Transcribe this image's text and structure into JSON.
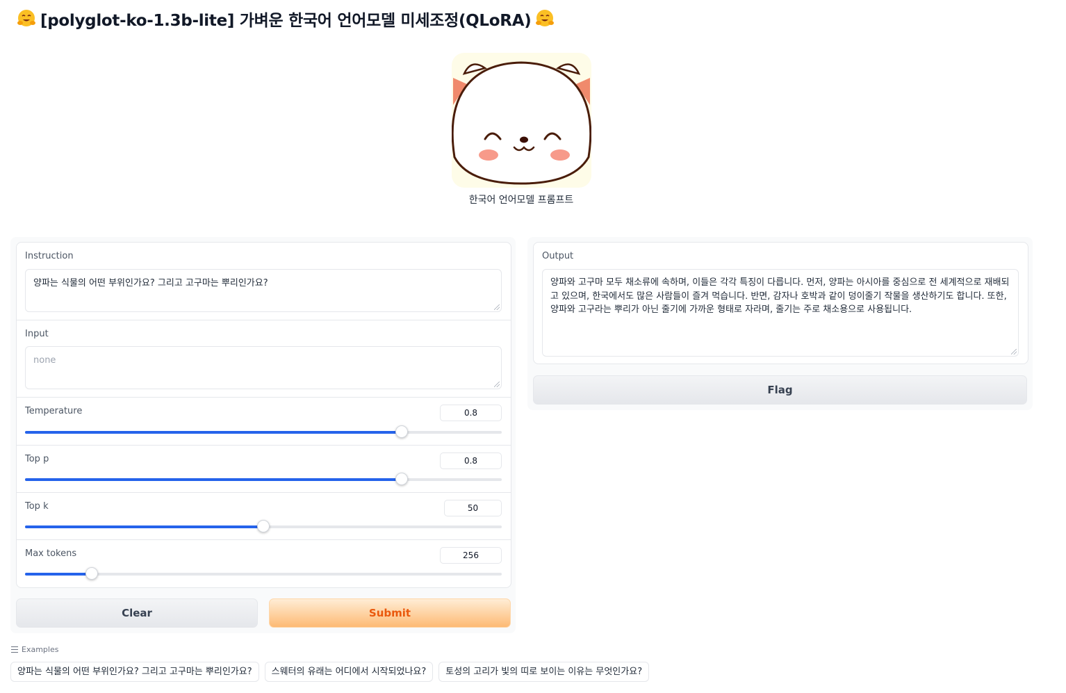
{
  "header": {
    "title": "[polyglot-ko-1.3b-lite] 가벼운 한국어 언어모델 미세조정(QLoRA)",
    "emoji_icon": "hugging-face-icon"
  },
  "mascot": {
    "icon": "cat-face-mascot",
    "caption": "한국어 언어모델 프롬프트"
  },
  "inputs": {
    "instruction": {
      "label": "Instruction",
      "value": "양파는 식물의 어떤 부위인가요? 그리고 고구마는 뿌리인가요?"
    },
    "input": {
      "label": "Input",
      "placeholder": "none"
    },
    "sliders": [
      {
        "label": "Temperature",
        "value": "0.8",
        "level": 0.79
      },
      {
        "label": "Top p",
        "value": "0.8",
        "level": 0.79
      },
      {
        "label": "Top k",
        "value": "50",
        "level": 0.5
      },
      {
        "label": "Max tokens",
        "value": "256",
        "level": 0.14
      }
    ]
  },
  "buttons": {
    "clear": "Clear",
    "submit": "Submit",
    "flag": "Flag"
  },
  "output": {
    "label": "Output",
    "value": "양파와 고구마 모두 채소류에 속하며, 이들은 각각 특징이 다릅니다. 먼저, 양파는 아시아를 중심으로 전 세계적으로 재배되고 있으며, 한국에서도 많은 사람들이 즐겨 먹습니다. 반면, 감자나 호박과 같이 덩이줄기 작물을 생산하기도 합니다. 또한, 양파와 고구라는 뿌리가 아닌 줄기에 가까운 형태로 자라며, 줄기는 주로 채소용으로 사용됩니다."
  },
  "examples": {
    "heading": "Examples",
    "items": [
      "양파는 식물의 어떤 부위인가요? 그리고 고구마는 뿌리인가요?",
      "스웨터의 유래는 어디에서 시작되었나요?",
      "토성의 고리가 빛의 띠로 보이는 이유는 무엇인가요?"
    ]
  },
  "colors": {
    "accent": "#2563eb",
    "primary_button": "#fdba74",
    "primary_text": "#ea580c"
  }
}
